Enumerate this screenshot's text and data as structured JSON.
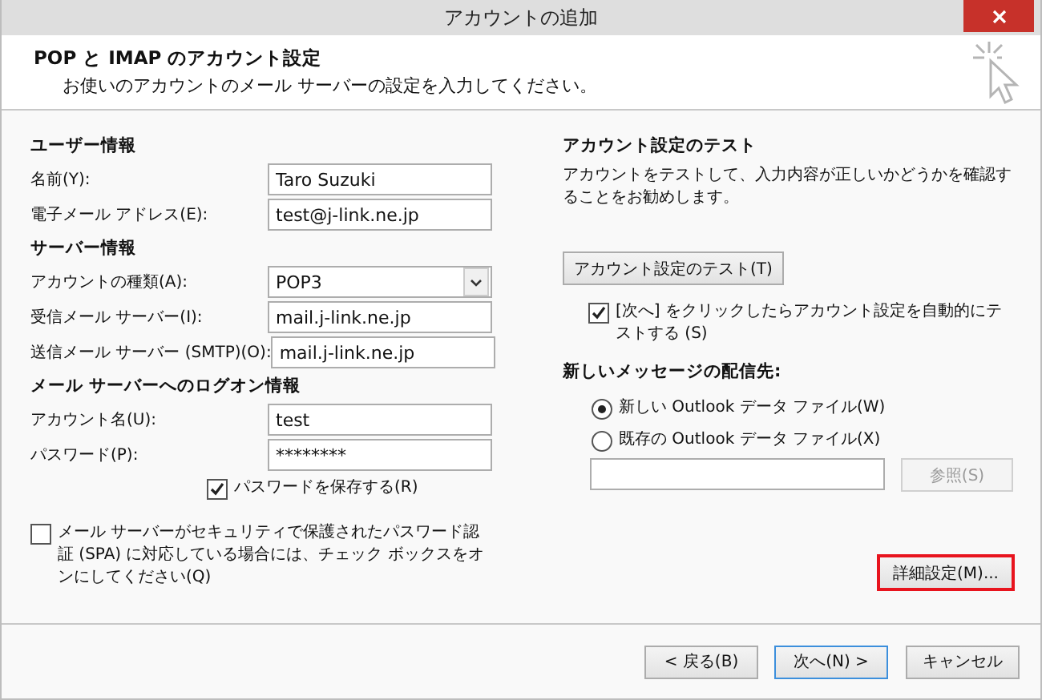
{
  "window": {
    "title": "アカウントの追加"
  },
  "header": {
    "title": "POP と IMAP のアカウント設定",
    "subtitle": "お使いのアカウントのメール サーバーの設定を入力してください。"
  },
  "sections": [
    {
      "heading": "ユーザー情報",
      "fields": [
        {
          "label": "名前(Y):",
          "kind": "text",
          "value": "Taro Suzuki"
        },
        {
          "label": "電子メール アドレス(E):",
          "kind": "text",
          "value": "test@j-link.ne.jp"
        }
      ]
    },
    {
      "heading": "サーバー情報",
      "fields": [
        {
          "label": "アカウントの種類(A):",
          "kind": "select",
          "value": "POP3"
        },
        {
          "label": "受信メール サーバー(I):",
          "kind": "text",
          "value": "mail.j-link.ne.jp"
        },
        {
          "label": "送信メール サーバー (SMTP)(O):",
          "kind": "text",
          "value": "mail.j-link.ne.jp"
        }
      ]
    },
    {
      "heading": "メール サーバーへのログオン情報",
      "fields": [
        {
          "label": "アカウント名(U):",
          "kind": "text",
          "value": "test"
        },
        {
          "label": "パスワード(P):",
          "kind": "password",
          "value": "********"
        }
      ]
    }
  ],
  "save_password": {
    "label": "パスワードを保存する(R)",
    "checked": true
  },
  "spa": {
    "label": "メール サーバーがセキュリティで保護されたパスワード認証 (SPA) に対応している場合には、チェック ボックスをオンにしてください(Q)",
    "checked": false
  },
  "test": {
    "heading": "アカウント設定のテスト",
    "description": "アカウントをテストして、入力内容が正しいかどうかを確認することをお勧めします。",
    "button": "アカウント設定のテスト(T)",
    "auto_test": {
      "label": "[次へ] をクリックしたらアカウント設定を自動的にテストする (S)",
      "checked": true
    }
  },
  "delivery": {
    "heading": "新しいメッセージの配信先:",
    "options": [
      {
        "label": "新しい Outlook データ ファイル(W)",
        "selected": true
      },
      {
        "label": "既存の Outlook データ ファイル(X)",
        "selected": false
      }
    ],
    "browse": {
      "label": "参照(S)",
      "disabled": true
    }
  },
  "advanced": {
    "label": "詳細設定(M)...",
    "highlighted": true
  },
  "footer_buttons": [
    {
      "label": "< 戻る(B)",
      "default": false
    },
    {
      "label": "次へ(N) >",
      "default": true
    },
    {
      "label": "キャンセル",
      "default": false
    }
  ]
}
